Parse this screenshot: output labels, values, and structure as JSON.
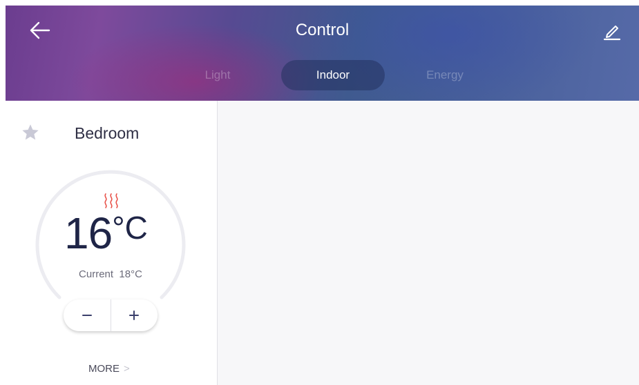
{
  "header": {
    "title": "Control",
    "back_icon": "arrow-left-icon",
    "edit_icon": "pencil-icon",
    "tabs": [
      {
        "label": "Light",
        "active": false
      },
      {
        "label": "Indoor",
        "active": true
      },
      {
        "label": "Energy",
        "active": false
      }
    ]
  },
  "room": {
    "name": "Bedroom",
    "favorite_icon": "star-icon",
    "mode_icon": "heat-icon",
    "target_temp": "16",
    "unit": "°C",
    "current_label": "Current",
    "current_temp": "18°C",
    "decrease_label": "−",
    "increase_label": "+",
    "more_label": "MORE",
    "more_chevron": ">"
  },
  "colors": {
    "accent": "#1f2547",
    "heat": "#e8524a",
    "dial_ring": "#ececf1",
    "star": "#c9c9d6"
  }
}
